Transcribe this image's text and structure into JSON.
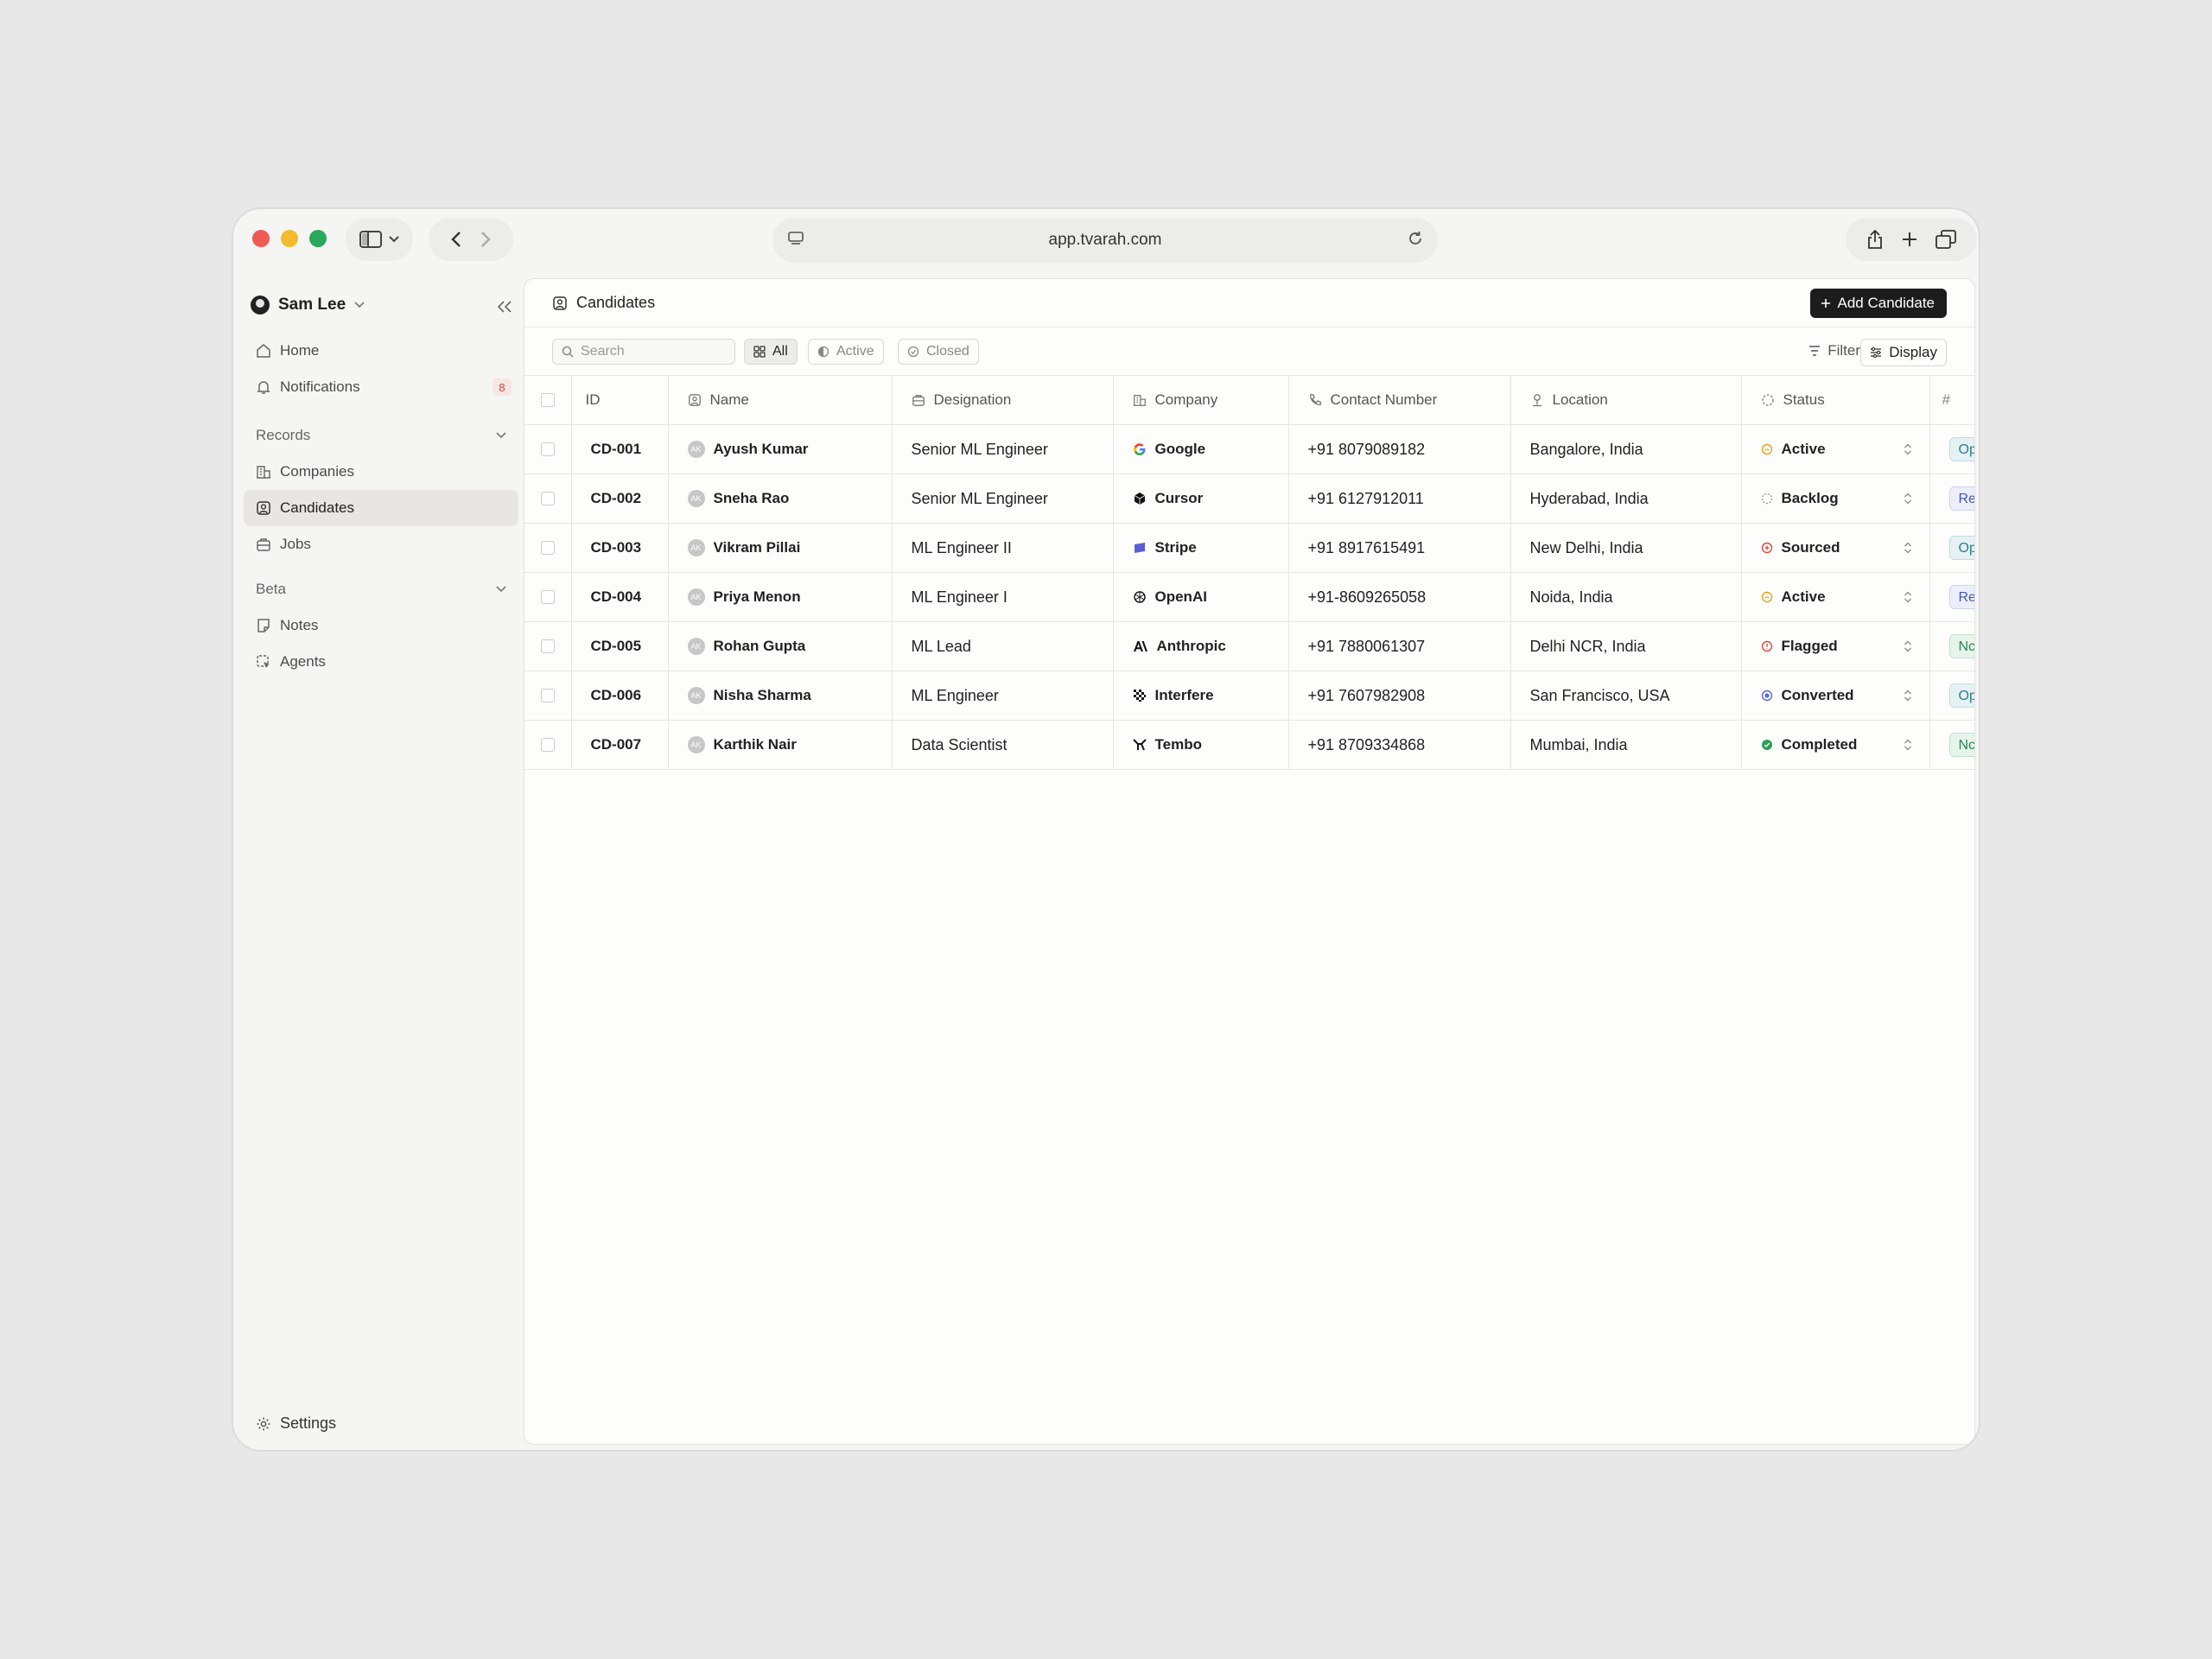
{
  "browser": {
    "url": "app.tvarah.com"
  },
  "sidebar": {
    "user_name": "Sam Lee",
    "items": [
      {
        "label": "Home",
        "icon": "home-icon"
      },
      {
        "label": "Notifications",
        "icon": "bell-icon",
        "badge": "8"
      }
    ],
    "sections": [
      {
        "title": "Records",
        "items": [
          {
            "label": "Companies",
            "icon": "building-icon"
          },
          {
            "label": "Candidates",
            "icon": "person-square-icon",
            "active": true
          },
          {
            "label": "Jobs",
            "icon": "briefcase-icon"
          }
        ]
      },
      {
        "title": "Beta",
        "items": [
          {
            "label": "Notes",
            "icon": "note-icon"
          },
          {
            "label": "Agents",
            "icon": "agent-icon"
          }
        ]
      }
    ],
    "settings_label": "Settings"
  },
  "page": {
    "title": "Candidates",
    "add_button": "Add Candidate"
  },
  "toolbar": {
    "search_placeholder": "Search",
    "tabs": [
      "All",
      "Active",
      "Closed"
    ],
    "selected_tab": "All",
    "filter_label": "Filter",
    "display_label": "Display"
  },
  "table": {
    "columns": [
      "ID",
      "Name",
      "Designation",
      "Company",
      "Contact Number",
      "Location",
      "Status",
      "#"
    ],
    "rows": [
      {
        "id": "CD-001",
        "initials": "AK",
        "name": "Ayush Kumar",
        "designation": "Senior ML Engineer",
        "company": "Google",
        "contact": "+91 8079089182",
        "location": "Bangalore, India",
        "status": "Active",
        "status_color": "#e8a21a",
        "tag": "Op"
      },
      {
        "id": "CD-002",
        "initials": "AK",
        "name": "Sneha Rao",
        "designation": "Senior ML Engineer",
        "company": "Cursor",
        "contact": "+91 6127912011",
        "location": "Hyderabad, India",
        "status": "Backlog",
        "status_color": "#9a9a9a",
        "tag": "Re"
      },
      {
        "id": "CD-003",
        "initials": "AK",
        "name": "Vikram Pillai",
        "designation": "ML Engineer II",
        "company": "Stripe",
        "contact": "+91 8917615491",
        "location": "New Delhi, India",
        "status": "Sourced",
        "status_color": "#e0483e",
        "tag": "Op"
      },
      {
        "id": "CD-004",
        "initials": "AK",
        "name": "Priya Menon",
        "designation": "ML Engineer I",
        "company": "OpenAI",
        "contact": "+91-8609265058",
        "location": "Noida, India",
        "status": "Active",
        "status_color": "#e8a21a",
        "tag": "Re"
      },
      {
        "id": "CD-005",
        "initials": "AK",
        "name": "Rohan Gupta",
        "designation": "ML Lead",
        "company": "Anthropic",
        "contact": "+91 7880061307",
        "location": "Delhi NCR, India",
        "status": "Flagged",
        "status_color": "#e0483e",
        "tag": "Nc"
      },
      {
        "id": "CD-006",
        "initials": "AK",
        "name": "Nisha Sharma",
        "designation": "ML Engineer",
        "company": "Interfere",
        "contact": "+91 7607982908",
        "location": "San Francisco, USA",
        "status": "Converted",
        "status_color": "#5b6ad8",
        "tag": "Op"
      },
      {
        "id": "CD-007",
        "initials": "AK",
        "name": "Karthik Nair",
        "designation": "Data Scientist",
        "company": "Tembo",
        "contact": "+91 8709334868",
        "location": "Mumbai, India",
        "status": "Completed",
        "status_color": "#2f9e5b",
        "tag": "Nc"
      }
    ]
  }
}
